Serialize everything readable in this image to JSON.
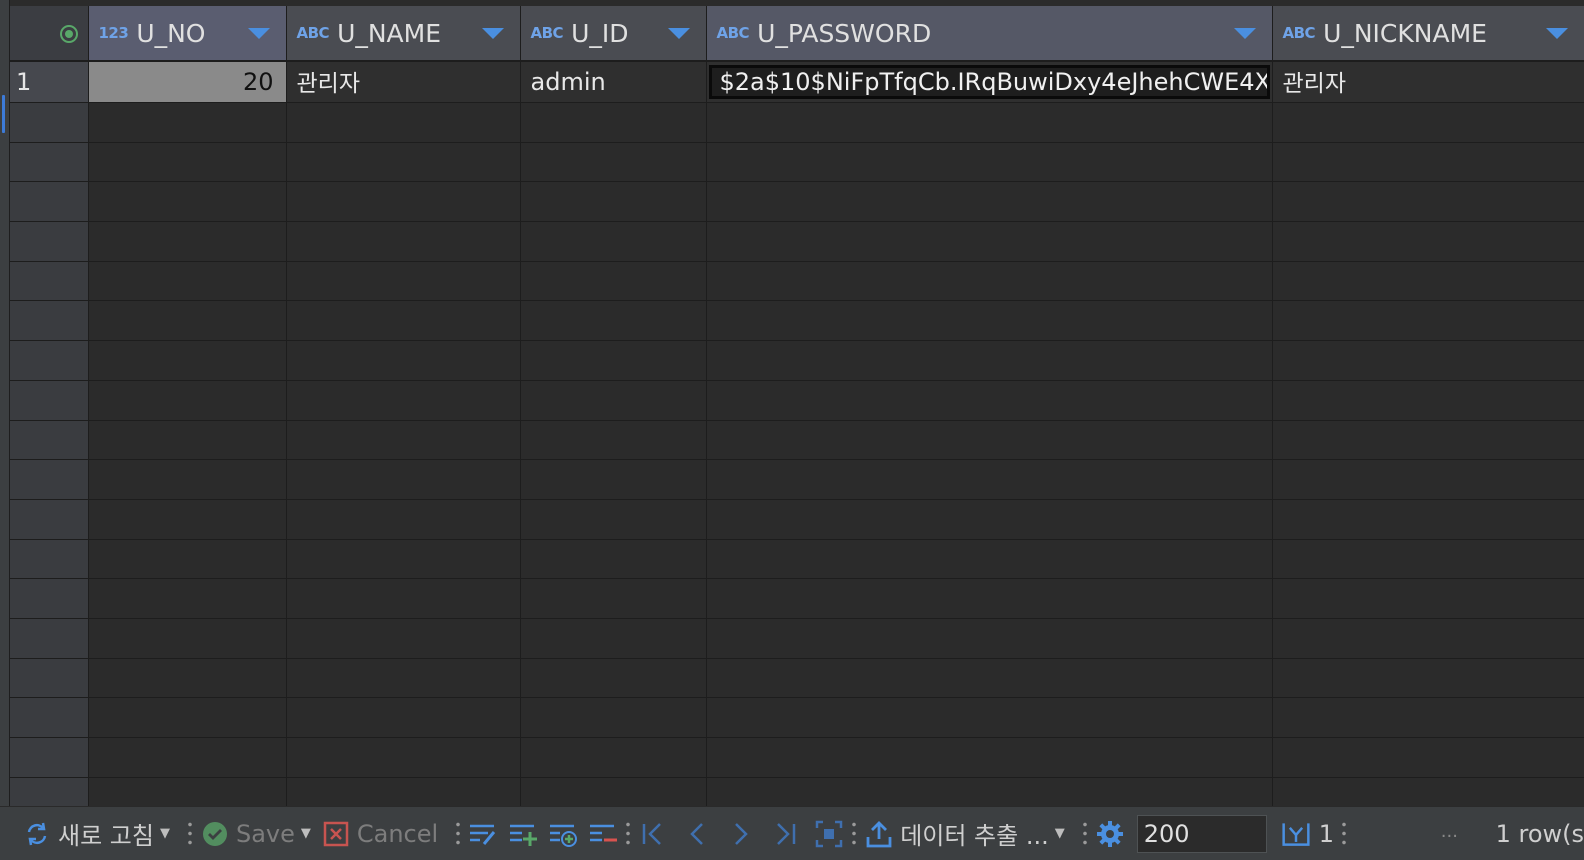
{
  "grid": {
    "columns": [
      {
        "type": "123",
        "name": "U_NO"
      },
      {
        "type": "ABC",
        "name": "U_NAME"
      },
      {
        "type": "ABC",
        "name": "U_ID"
      },
      {
        "type": "ABC",
        "name": "U_PASSWORD"
      },
      {
        "type": "ABC",
        "name": "U_NICKNAME"
      }
    ],
    "rows": [
      {
        "row_number": "1",
        "u_no": "20",
        "u_name": "관리자",
        "u_id": "admin",
        "u_password": "$2a$10$NiFpTfqCb.IRqBuwiDxy4eJhehCWE4X",
        "u_nickname": "관리자"
      }
    ]
  },
  "toolbar": {
    "refresh_label": "새로 고침",
    "save_label": "Save",
    "cancel_label": "Cancel",
    "export_label": "데이터 추출 ...",
    "fetch_size": "200",
    "record_count": "1",
    "more": "···",
    "rows_status": "1 row(s"
  },
  "icons": {
    "status": "status-indicator-icon",
    "refresh": "refresh-icon",
    "save": "save-check-icon",
    "cancel": "cancel-icon",
    "edit_row": "edit-row-icon",
    "add_row": "add-row-icon",
    "copy_row": "copy-row-icon",
    "delete_row": "delete-row-icon",
    "first": "first-page-icon",
    "prev": "previous-icon",
    "next": "next-icon",
    "last": "last-page-icon",
    "fetch_all": "fetch-all-icon",
    "export": "export-icon",
    "settings": "gear-icon",
    "fetch_next": "fetch-next-icon"
  },
  "colors": {
    "accent": "#4a8fe0",
    "save_green": "#59a869",
    "add_green": "#59a869",
    "delete_red": "#d9534f",
    "cancel_red": "#c75450",
    "selected_cell_bg": "#8a8a8a"
  }
}
